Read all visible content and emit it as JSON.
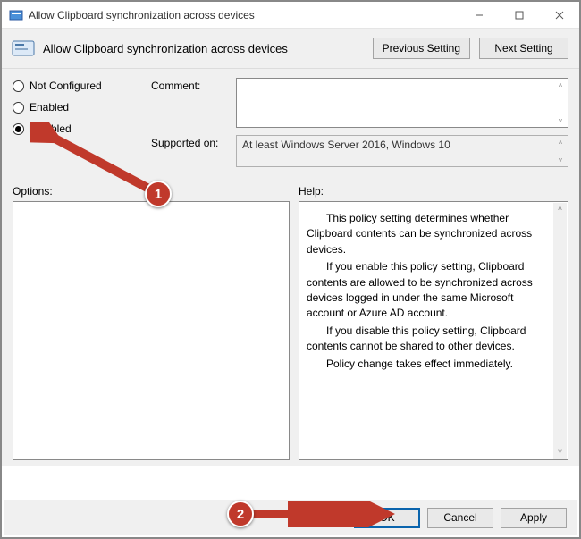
{
  "window": {
    "title": "Allow Clipboard synchronization across devices"
  },
  "header": {
    "title": "Allow Clipboard synchronization across devices",
    "prev": "Previous Setting",
    "next": "Next Setting"
  },
  "radios": {
    "not_configured": "Not Configured",
    "enabled": "Enabled",
    "disabled": "Disabled",
    "selected": "disabled"
  },
  "fields": {
    "comment_label": "Comment:",
    "comment_value": "",
    "supported_label": "Supported on:",
    "supported_value": "At least Windows Server 2016, Windows 10"
  },
  "sections": {
    "options_label": "Options:",
    "help_label": "Help:"
  },
  "help_paragraphs": [
    "This policy setting determines whether Clipboard contents can be synchronized across devices.",
    "If you enable this policy setting, Clipboard contents are allowed to be synchronized across devices logged in under the same Microsoft account or Azure AD account.",
    "If you disable this policy setting, Clipboard contents cannot be shared to other devices.",
    "Policy change takes effect immediately."
  ],
  "buttons": {
    "ok": "OK",
    "cancel": "Cancel",
    "apply": "Apply"
  },
  "annotations": {
    "badge1": "1",
    "badge2": "2"
  }
}
